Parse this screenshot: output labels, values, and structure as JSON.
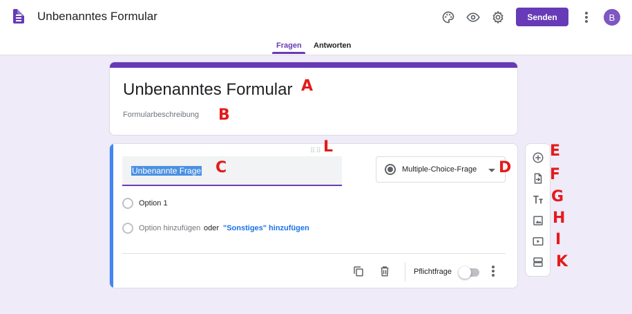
{
  "header": {
    "title": "Unbenanntes Formular",
    "send_label": "Senden",
    "avatar_letter": "B",
    "icons": [
      "palette-icon",
      "eye-icon",
      "gear-icon",
      "more-vert-icon"
    ]
  },
  "tabs": [
    {
      "label": "Fragen",
      "active": true
    },
    {
      "label": "Antworten",
      "active": false
    }
  ],
  "form": {
    "title": "Unbenanntes Formular",
    "description_placeholder": "Formularbeschreibung"
  },
  "question": {
    "title": "Unbenannte Frage",
    "type": "Multiple-Choice-Frage",
    "options": [
      "Option 1"
    ],
    "add_option": "Option hinzufügen",
    "or_text": "oder",
    "add_other": "\"Sonstiges\" hinzufügen",
    "required_label": "Pflichtfrage",
    "required": false
  },
  "toolbar": [
    "add-question-icon",
    "import-questions-icon",
    "title-description-icon",
    "image-icon",
    "video-icon",
    "section-icon"
  ],
  "markers": {
    "A": "A",
    "B": "B",
    "C": "C",
    "D": "D",
    "E": "E",
    "F": "F",
    "G": "G",
    "H": "H",
    "I": "I",
    "K": "K",
    "L": "L"
  },
  "colors": {
    "accent": "#673ab7",
    "background": "#f0ebf8",
    "question_border": "#4285f4",
    "marker": "#e31b1b"
  }
}
